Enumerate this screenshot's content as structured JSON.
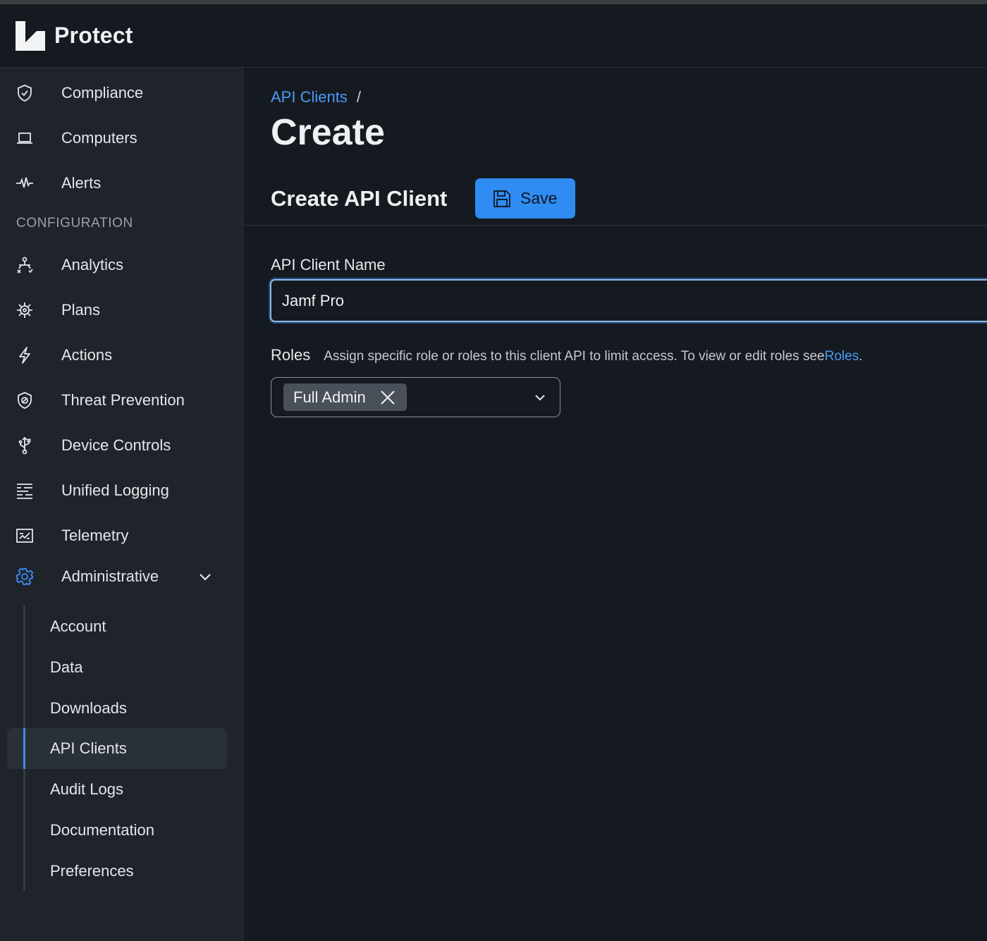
{
  "app": {
    "title": "Protect"
  },
  "sidebar": {
    "items": [
      {
        "label": "Compliance",
        "icon": "shield-check-icon"
      },
      {
        "label": "Computers",
        "icon": "laptop-icon"
      },
      {
        "label": "Alerts",
        "icon": "pulse-icon"
      }
    ],
    "section_label": "CONFIGURATION",
    "config_items": [
      {
        "label": "Analytics",
        "icon": "analytics-icon"
      },
      {
        "label": "Plans",
        "icon": "virus-icon"
      },
      {
        "label": "Actions",
        "icon": "lightning-icon"
      },
      {
        "label": "Threat Prevention",
        "icon": "shield-block-icon"
      },
      {
        "label": "Device Controls",
        "icon": "usb-icon"
      },
      {
        "label": "Unified Logging",
        "icon": "logging-icon"
      },
      {
        "label": "Telemetry",
        "icon": "telemetry-icon"
      }
    ],
    "admin": {
      "label": "Administrative",
      "icon": "gear-icon",
      "expanded": true
    },
    "admin_items": [
      {
        "label": "Account"
      },
      {
        "label": "Data"
      },
      {
        "label": "Downloads"
      },
      {
        "label": "API Clients",
        "active": true
      },
      {
        "label": "Audit Logs"
      },
      {
        "label": "Documentation"
      },
      {
        "label": "Preferences"
      }
    ]
  },
  "main": {
    "breadcrumb": {
      "link": "API Clients",
      "separator": "/"
    },
    "title": "Create",
    "section_title": "Create API Client",
    "save_label": "Save",
    "name_field": {
      "label": "API Client Name",
      "value": "Jamf Pro"
    },
    "roles": {
      "label": "Roles",
      "help": "Assign specific role or roles to this client API to limit access. To view or edit roles see ",
      "link": "Roles",
      "suffix": ".",
      "selected": [
        "Full Admin"
      ]
    }
  },
  "colors": {
    "accent": "#2f8cf2",
    "link": "#4b9af4",
    "background": "#151a21",
    "sidebar": "#1f242b"
  }
}
